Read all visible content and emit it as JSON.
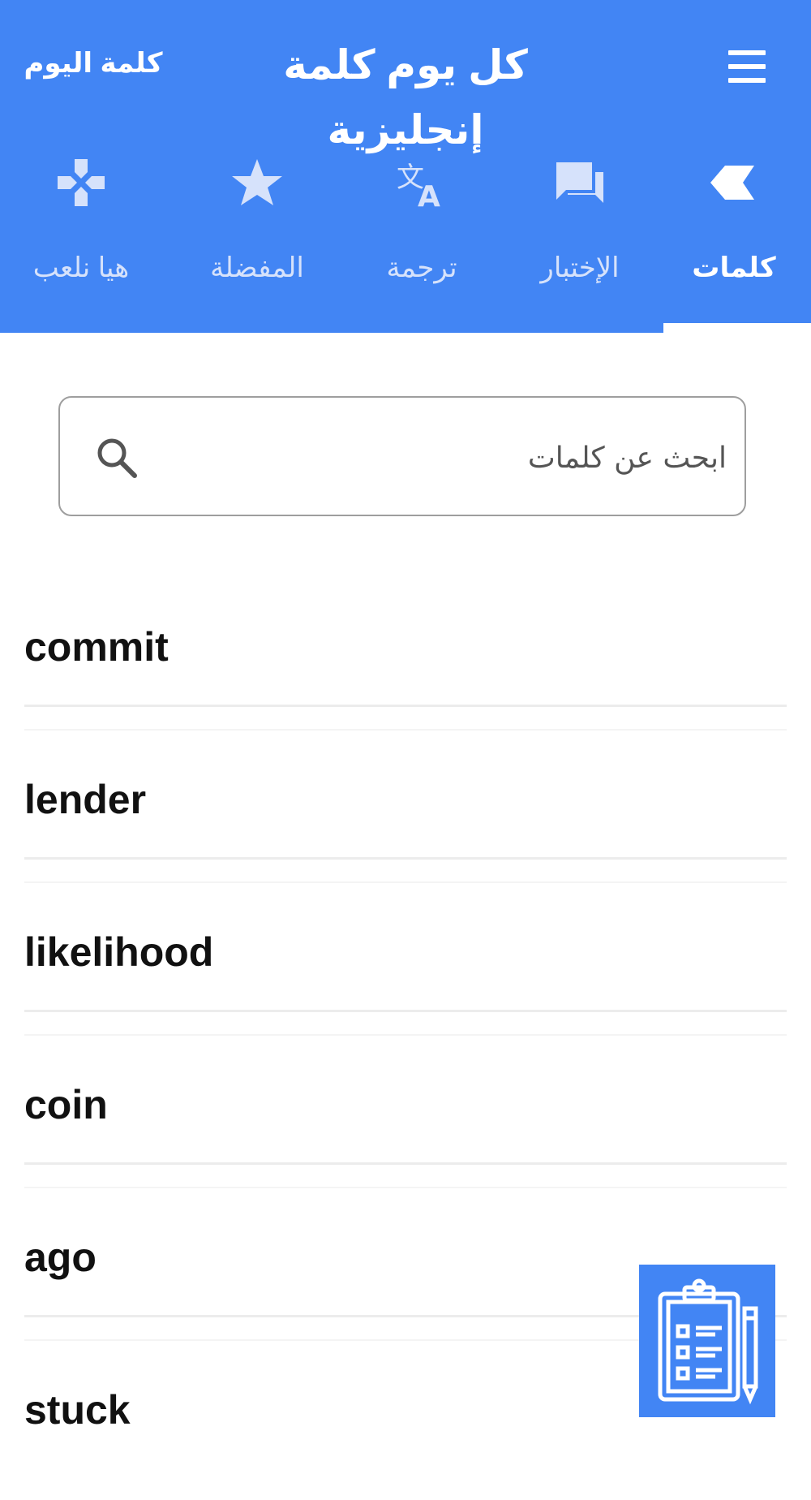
{
  "header": {
    "title": "كل يوم كلمة إنجليزية",
    "word_of_day": "كلمة اليوم",
    "menu_icon": "hamburger-menu-icon",
    "accent_color": "#4285f4"
  },
  "tabs": [
    {
      "label": "كلمات",
      "icon": "chevron-left-icon",
      "active": true
    },
    {
      "label": "الإختبار",
      "icon": "chat-bubbles-icon",
      "active": false
    },
    {
      "label": "ترجمة",
      "icon": "translate-icon",
      "active": false
    },
    {
      "label": "المفضلة",
      "icon": "star-icon",
      "active": false
    },
    {
      "label": "هيا نلعب",
      "icon": "gamepad-icon",
      "active": false
    }
  ],
  "search": {
    "placeholder": "ابحث عن كلمات",
    "value": "",
    "icon": "search-icon"
  },
  "words": [
    "commit",
    "lender",
    "likelihood",
    "coin",
    "ago",
    "stuck"
  ],
  "fab": {
    "icon": "clipboard-checklist-icon"
  }
}
